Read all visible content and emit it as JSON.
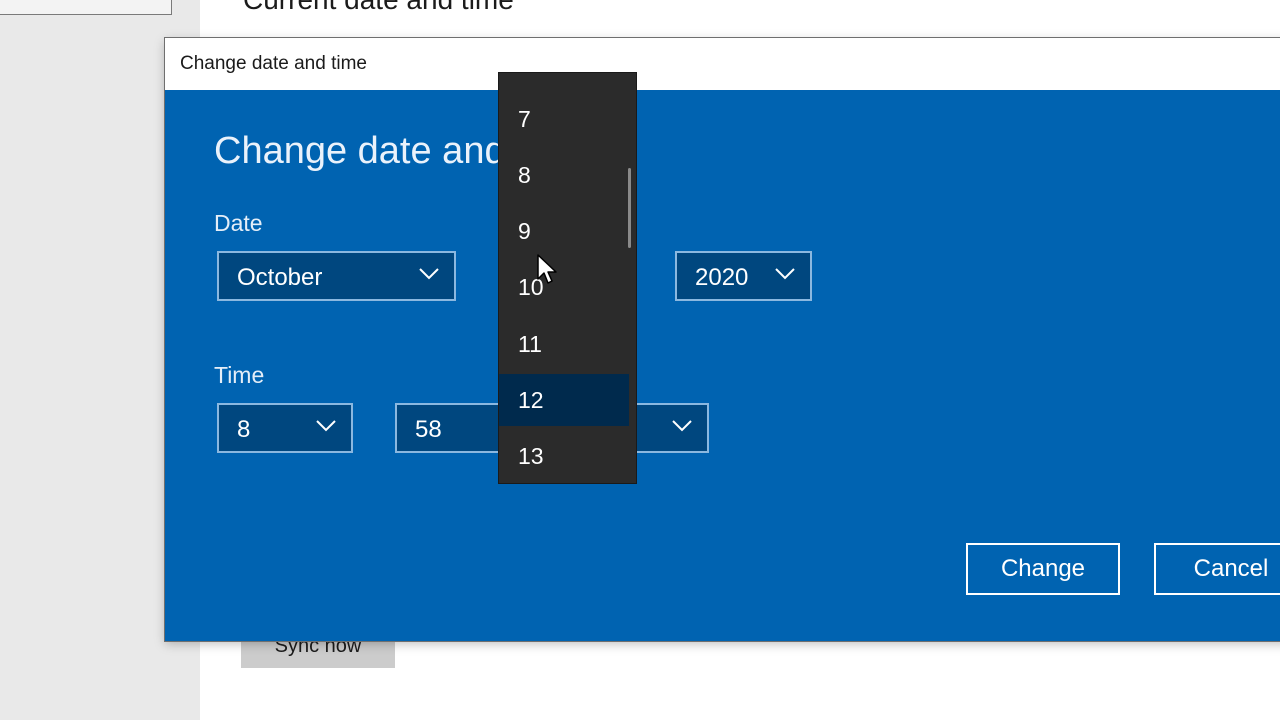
{
  "background": {
    "heading": "Current date and time",
    "sync_button": "Sync now"
  },
  "dialog": {
    "title": "Change date and time",
    "heading": "Change date and time",
    "date_label": "Date",
    "time_label": "Time",
    "month": "October",
    "year": "2020",
    "hour": "8",
    "minute": "58",
    "change_button": "Change",
    "cancel_button": "Cancel"
  },
  "dropdown": {
    "items": [
      "7",
      "8",
      "9",
      "10",
      "11",
      "12",
      "13"
    ],
    "selected": "12"
  },
  "colors": {
    "dialog_bg": "#0063b1",
    "combo_bg": "#00477f",
    "dropdown_bg": "#2b2b2b",
    "dropdown_selected": "#002a4d"
  },
  "icons": [
    "chevron-down-icon",
    "mouse-cursor-icon"
  ]
}
